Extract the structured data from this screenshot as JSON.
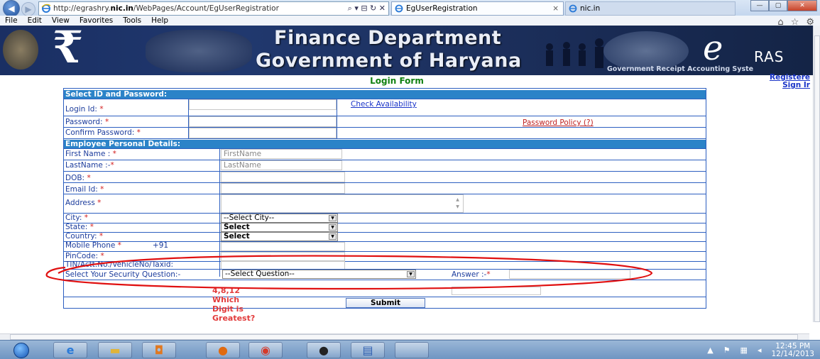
{
  "browser": {
    "url_prefix": "http://egrashry.",
    "url_domain": "nic.in",
    "url_suffix": "/WebPages/Account/EgUserRegistratior",
    "addr_tools": "⌕ ▾ ⊟ ↻ ✕",
    "tabs": [
      {
        "label": "EgUserRegistration",
        "close": "×"
      },
      {
        "label": "nic.in"
      }
    ],
    "menu": [
      "File",
      "Edit",
      "View",
      "Favorites",
      "Tools",
      "Help"
    ],
    "win_controls": {
      "minimize": "—",
      "maximize": "▢",
      "close": "✕"
    },
    "nav_icons": {
      "home": "⌂",
      "favorites": "☆",
      "settings": "⚙"
    }
  },
  "banner": {
    "line1": "Finance Department",
    "line2": "Government of Haryana",
    "rupee": "₹",
    "gras_e": "e",
    "gras_rest": "RAS",
    "subtitle": "Government Receipt Accounting Syste"
  },
  "page": {
    "form_title": "Login Form",
    "right_links": [
      "Registere",
      "Sign Ir"
    ]
  },
  "form": {
    "section1": "Select ID and Password:",
    "login_id_label": "Login Id:",
    "check_availability": "Check Availability",
    "password_label": "Password:",
    "password_policy": "Password Policy (?)",
    "confirm_password_label": "Confirm Password:",
    "section2": "Employee Personal Details:",
    "first_name_label": "First Name :",
    "first_name_placeholder": "FirstName",
    "last_name_label": "LastName :-",
    "last_name_placeholder": "LastName",
    "dob_label": "DOB:",
    "email_label": "Email Id:",
    "address_label": "Address",
    "city_label": "City:",
    "city_value": "--Select City--",
    "state_label": "State:",
    "state_value": "Select",
    "country_label": "Country:",
    "country_value": "Select",
    "mobile_label": "Mobile Phone",
    "mobile_prefix": "+91",
    "pincode_label": "PinCode:",
    "tin_label": "TIN/Actt.No./VehicleNo/Taxid:",
    "security_label": "Select Your Security Question:-",
    "security_value": "--Select Question--",
    "answer_label": "Answer :-",
    "captcha": "4,8,12 Which Digit is Greatest?",
    "submit": "Submit",
    "required_mark": "*"
  },
  "taskbar": {
    "time": "12:45 PM",
    "date": "12/14/2013",
    "tray_arrow": "▲"
  },
  "colors": {
    "section_header": "#2b83c8",
    "label_blue": "#1c3c9c",
    "required_red": "#d21c1c",
    "title_green": "#108010",
    "annotation_red": "#e01010"
  }
}
